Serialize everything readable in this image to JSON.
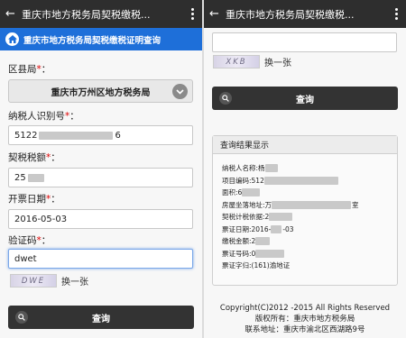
{
  "left": {
    "appbar_title": "重庆市地方税务局契税缴税...",
    "headline": "重庆市地方税务局契税缴税证明查询",
    "district_label": "区县局",
    "district_value": "重庆市万州区地方税务局",
    "taxpayer_id_label": "纳税人识别号",
    "taxpayer_id_prefix": "5122",
    "taxpayer_id_suffix": "6",
    "tax_amount_label": "契税税额",
    "tax_amount_value": "25",
    "issue_date_label": "开票日期",
    "issue_date_value": "2016-05-03",
    "captcha_label": "验证码",
    "captcha_value": "dwet",
    "captcha_image_text": "DWE",
    "refresh_label": "换一张",
    "query_button": "查询"
  },
  "right": {
    "appbar_title": "重庆市地方税务局契税缴税...",
    "captcha_image_text": "XKB",
    "refresh_label": "换一张",
    "query_button": "查询",
    "result_title": "查询结果显示",
    "result_rows": [
      {
        "label": "纳税人名称:杨"
      },
      {
        "label": "项目编码:512"
      },
      {
        "label": "面积:6"
      },
      {
        "label": "房屋坐落地址:万",
        "tail": "室"
      },
      {
        "label": "契税计税依据:2"
      },
      {
        "label": "票证日期:2016-",
        "tail": "-03"
      },
      {
        "label": "缴税金额:2"
      },
      {
        "label": "票证号码:0"
      },
      {
        "label": "票证字归:(161)渝地证"
      }
    ],
    "footer": {
      "copyright": "Copyright(C)2012 -2015 All Rights Reserved",
      "owner": "版权所有：重庆市地方税务局",
      "address": "联系地址：重庆市渝北区西湖路9号"
    }
  },
  "colors": {
    "appbar": "#2e2e2e",
    "headline": "#1e6fd9",
    "button": "#333333",
    "required": "#dd0000"
  },
  "icons": [
    "back-arrow-icon",
    "more-vertical-icon",
    "home-icon",
    "chevron-down-icon",
    "search-icon"
  ]
}
